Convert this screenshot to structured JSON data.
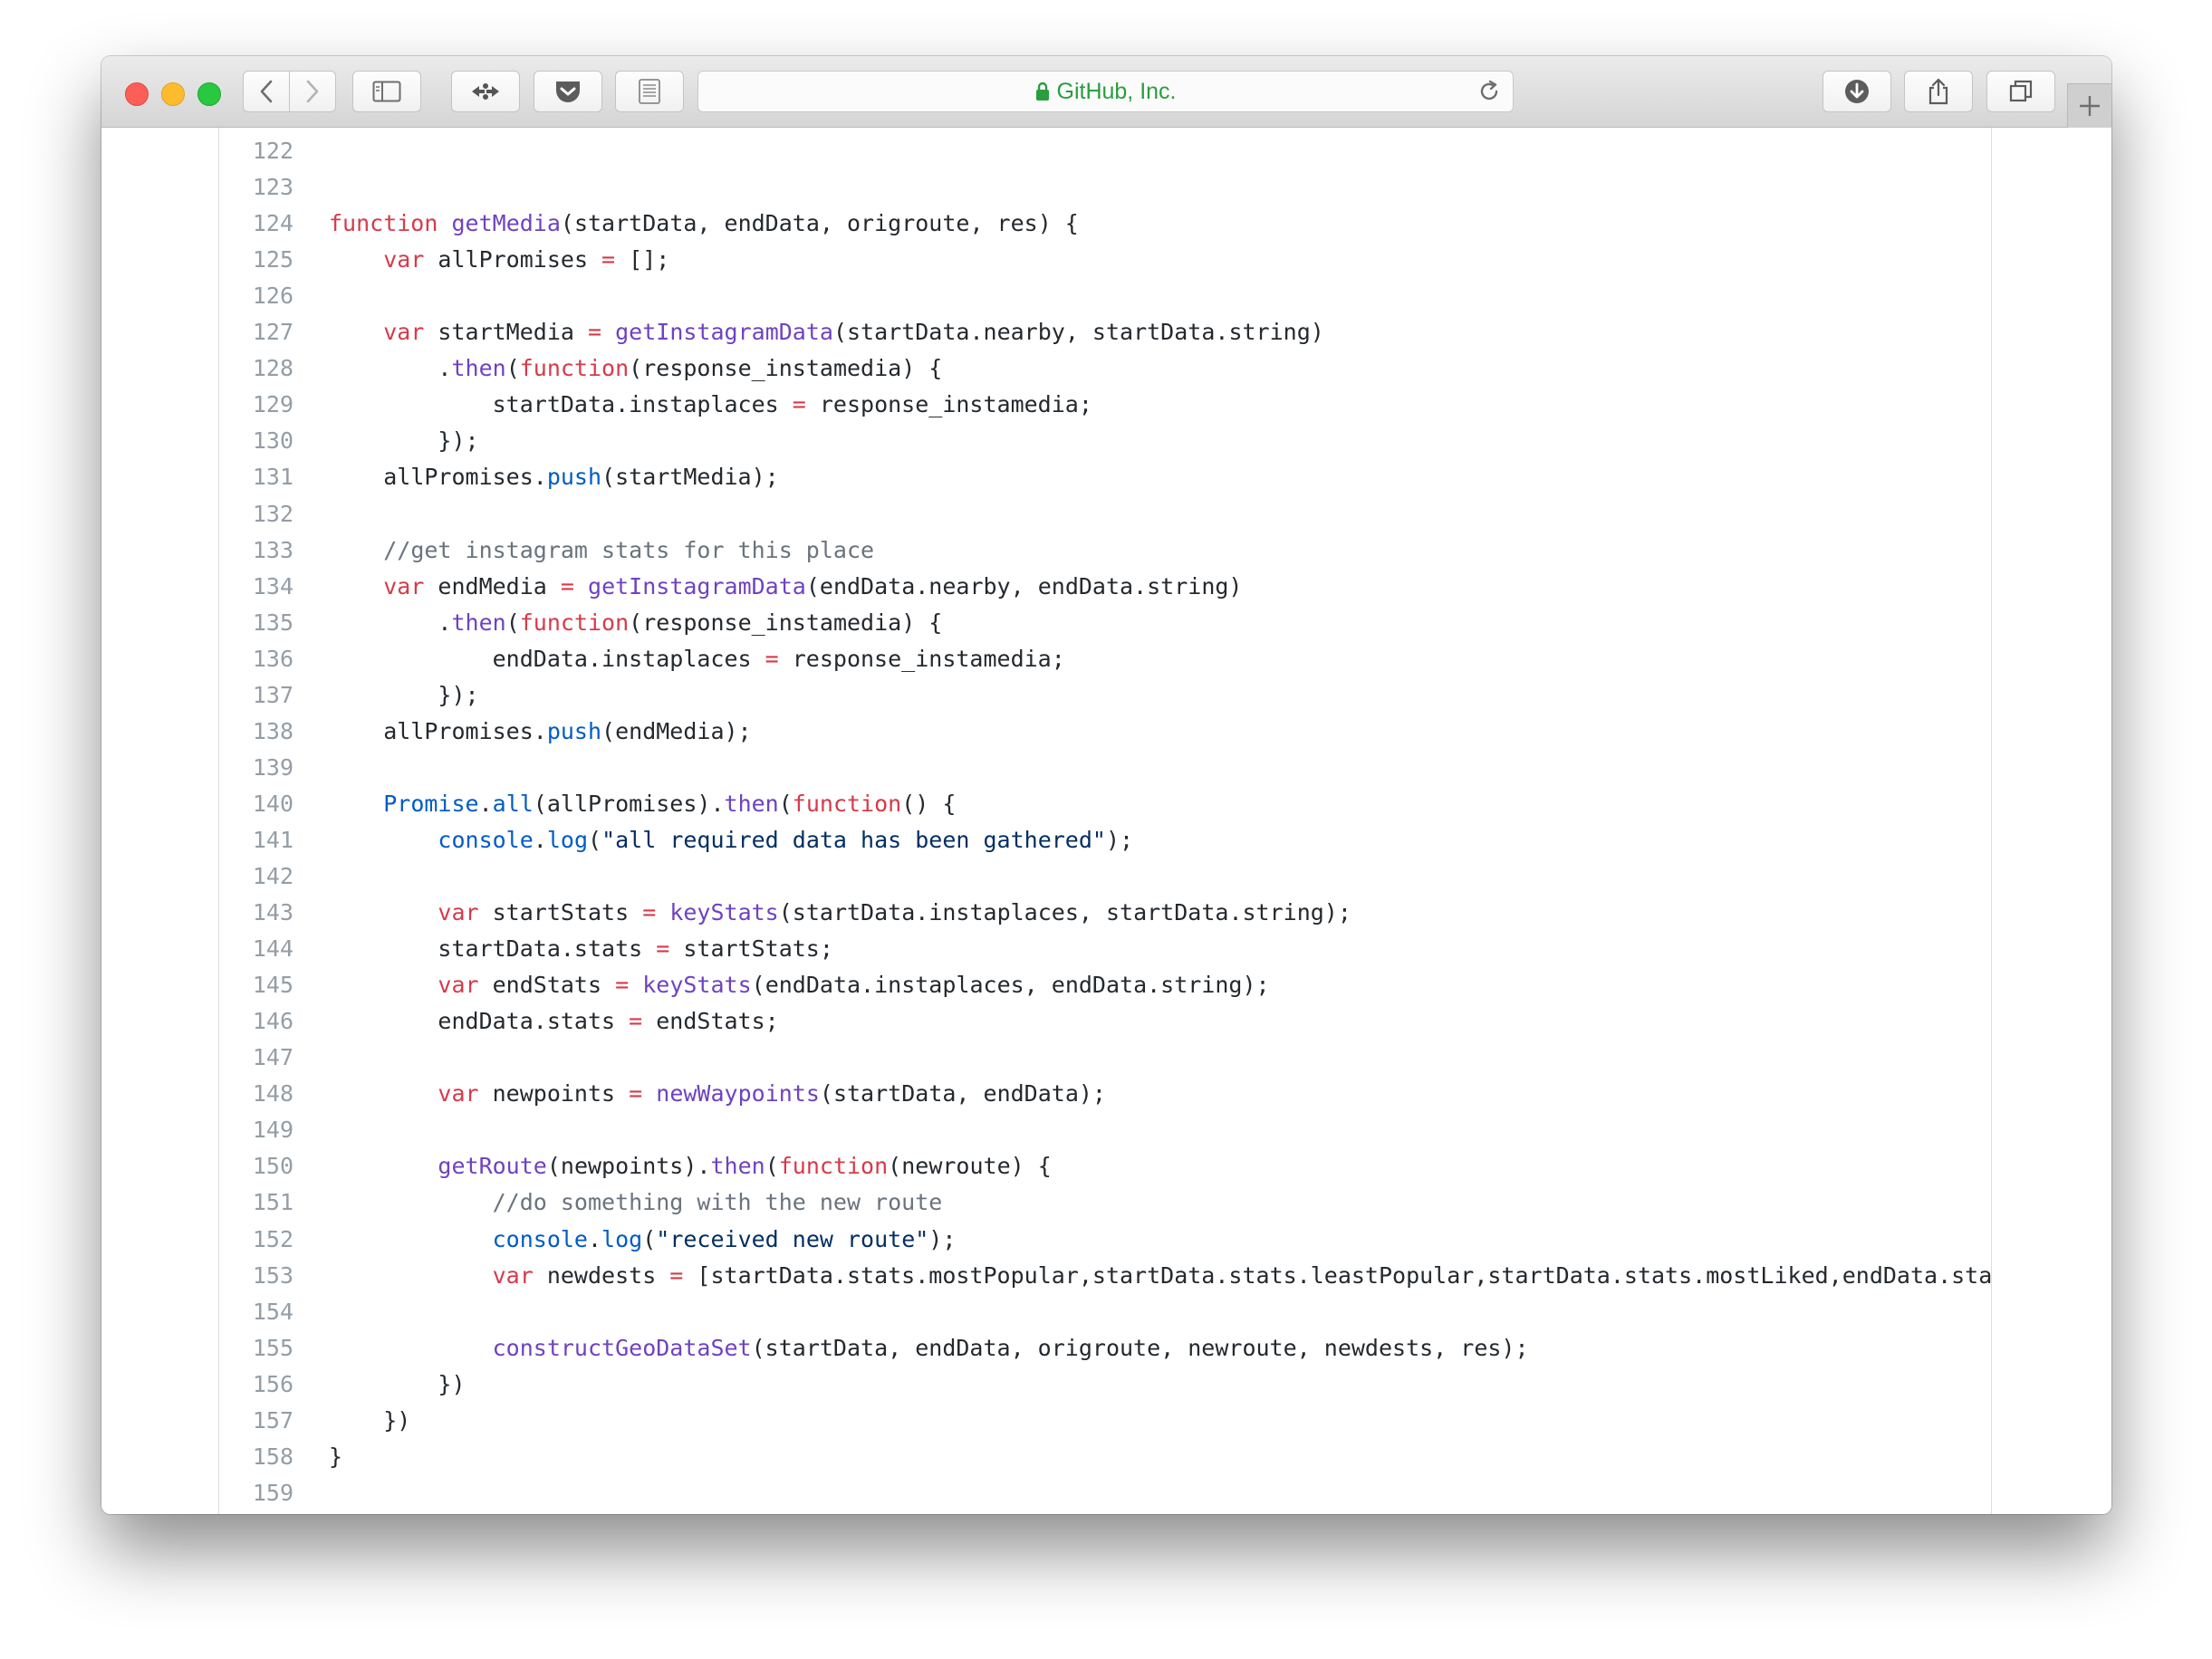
{
  "browser": {
    "address_host": "GitHub, Inc.",
    "toolbar_icons": [
      "back-icon",
      "forward-icon",
      "sidebar-icon",
      "extension-icon",
      "pocket-icon",
      "reader-icon",
      "reload-icon",
      "download-icon",
      "share-icon",
      "tabs-icon",
      "new-tab-icon"
    ]
  },
  "code": {
    "lines": [
      {
        "n": "122",
        "t": []
      },
      {
        "n": "123",
        "t": []
      },
      {
        "n": "124",
        "t": [
          [
            "k",
            "function"
          ],
          [
            "t",
            " "
          ],
          [
            "f",
            "getMedia"
          ],
          [
            "t",
            "(startData, endData, origroute, res) {"
          ]
        ]
      },
      {
        "n": "125",
        "t": [
          [
            "t",
            "    "
          ],
          [
            "k",
            "var"
          ],
          [
            "t",
            " allPromises "
          ],
          [
            "k",
            "="
          ],
          [
            "t",
            " [];"
          ]
        ]
      },
      {
        "n": "126",
        "t": []
      },
      {
        "n": "127",
        "t": [
          [
            "t",
            "    "
          ],
          [
            "k",
            "var"
          ],
          [
            "t",
            " startMedia "
          ],
          [
            "k",
            "="
          ],
          [
            "t",
            " "
          ],
          [
            "f",
            "getInstagramData"
          ],
          [
            "t",
            "(startData.nearby, startData.string)"
          ]
        ]
      },
      {
        "n": "128",
        "t": [
          [
            "t",
            "        ."
          ],
          [
            "f",
            "then"
          ],
          [
            "t",
            "("
          ],
          [
            "k",
            "function"
          ],
          [
            "t",
            "(response_instamedia) {"
          ]
        ]
      },
      {
        "n": "129",
        "t": [
          [
            "t",
            "            startData.instaplaces "
          ],
          [
            "k",
            "="
          ],
          [
            "t",
            " response_instamedia;"
          ]
        ]
      },
      {
        "n": "130",
        "t": [
          [
            "t",
            "        });"
          ]
        ]
      },
      {
        "n": "131",
        "t": [
          [
            "t",
            "    allPromises."
          ],
          [
            "b",
            "push"
          ],
          [
            "t",
            "(startMedia);"
          ]
        ]
      },
      {
        "n": "132",
        "t": []
      },
      {
        "n": "133",
        "t": [
          [
            "t",
            "    "
          ],
          [
            "c",
            "//get instagram stats for this place"
          ]
        ]
      },
      {
        "n": "134",
        "t": [
          [
            "t",
            "    "
          ],
          [
            "k",
            "var"
          ],
          [
            "t",
            " endMedia "
          ],
          [
            "k",
            "="
          ],
          [
            "t",
            " "
          ],
          [
            "f",
            "getInstagramData"
          ],
          [
            "t",
            "(endData.nearby, endData.string)"
          ]
        ]
      },
      {
        "n": "135",
        "t": [
          [
            "t",
            "        ."
          ],
          [
            "f",
            "then"
          ],
          [
            "t",
            "("
          ],
          [
            "k",
            "function"
          ],
          [
            "t",
            "(response_instamedia) {"
          ]
        ]
      },
      {
        "n": "136",
        "t": [
          [
            "t",
            "            endData.instaplaces "
          ],
          [
            "k",
            "="
          ],
          [
            "t",
            " response_instamedia;"
          ]
        ]
      },
      {
        "n": "137",
        "t": [
          [
            "t",
            "        });"
          ]
        ]
      },
      {
        "n": "138",
        "t": [
          [
            "t",
            "    allPromises."
          ],
          [
            "b",
            "push"
          ],
          [
            "t",
            "(endMedia);"
          ]
        ]
      },
      {
        "n": "139",
        "t": []
      },
      {
        "n": "140",
        "t": [
          [
            "t",
            "    "
          ],
          [
            "b",
            "Promise"
          ],
          [
            "t",
            "."
          ],
          [
            "b",
            "all"
          ],
          [
            "t",
            "(allPromises)."
          ],
          [
            "f",
            "then"
          ],
          [
            "t",
            "("
          ],
          [
            "k",
            "function"
          ],
          [
            "t",
            "() {"
          ]
        ]
      },
      {
        "n": "141",
        "t": [
          [
            "t",
            "        "
          ],
          [
            "b",
            "console"
          ],
          [
            "t",
            "."
          ],
          [
            "b",
            "log"
          ],
          [
            "t",
            "("
          ],
          [
            "s",
            "\"all required data has been gathered\""
          ],
          [
            "t",
            ");"
          ]
        ]
      },
      {
        "n": "142",
        "t": []
      },
      {
        "n": "143",
        "t": [
          [
            "t",
            "        "
          ],
          [
            "k",
            "var"
          ],
          [
            "t",
            " startStats "
          ],
          [
            "k",
            "="
          ],
          [
            "t",
            " "
          ],
          [
            "f",
            "keyStats"
          ],
          [
            "t",
            "(startData.instaplaces, startData.string);"
          ]
        ]
      },
      {
        "n": "144",
        "t": [
          [
            "t",
            "        startData.stats "
          ],
          [
            "k",
            "="
          ],
          [
            "t",
            " startStats;"
          ]
        ]
      },
      {
        "n": "145",
        "t": [
          [
            "t",
            "        "
          ],
          [
            "k",
            "var"
          ],
          [
            "t",
            " endStats "
          ],
          [
            "k",
            "="
          ],
          [
            "t",
            " "
          ],
          [
            "f",
            "keyStats"
          ],
          [
            "t",
            "(endData.instaplaces, endData.string);"
          ]
        ]
      },
      {
        "n": "146",
        "t": [
          [
            "t",
            "        endData.stats "
          ],
          [
            "k",
            "="
          ],
          [
            "t",
            " endStats;"
          ]
        ]
      },
      {
        "n": "147",
        "t": []
      },
      {
        "n": "148",
        "t": [
          [
            "t",
            "        "
          ],
          [
            "k",
            "var"
          ],
          [
            "t",
            " newpoints "
          ],
          [
            "k",
            "="
          ],
          [
            "t",
            " "
          ],
          [
            "f",
            "newWaypoints"
          ],
          [
            "t",
            "(startData, endData);"
          ]
        ]
      },
      {
        "n": "149",
        "t": []
      },
      {
        "n": "150",
        "t": [
          [
            "t",
            "        "
          ],
          [
            "f",
            "getRoute"
          ],
          [
            "t",
            "(newpoints)."
          ],
          [
            "f",
            "then"
          ],
          [
            "t",
            "("
          ],
          [
            "k",
            "function"
          ],
          [
            "t",
            "(newroute) {"
          ]
        ]
      },
      {
        "n": "151",
        "t": [
          [
            "t",
            "            "
          ],
          [
            "c",
            "//do something with the new route"
          ]
        ]
      },
      {
        "n": "152",
        "t": [
          [
            "t",
            "            "
          ],
          [
            "b",
            "console"
          ],
          [
            "t",
            "."
          ],
          [
            "b",
            "log"
          ],
          [
            "t",
            "("
          ],
          [
            "s",
            "\"received new route\""
          ],
          [
            "t",
            ");"
          ]
        ]
      },
      {
        "n": "153",
        "t": [
          [
            "t",
            "            "
          ],
          [
            "k",
            "var"
          ],
          [
            "t",
            " newdests "
          ],
          [
            "k",
            "="
          ],
          [
            "t",
            " [startData.stats.mostPopular,startData.stats.leastPopular,startData.stats.mostLiked,endData.stats.mo"
          ]
        ]
      },
      {
        "n": "154",
        "t": []
      },
      {
        "n": "155",
        "t": [
          [
            "t",
            "            "
          ],
          [
            "f",
            "constructGeoDataSet"
          ],
          [
            "t",
            "(startData, endData, origroute, newroute, newdests, res);"
          ]
        ]
      },
      {
        "n": "156",
        "t": [
          [
            "t",
            "        })"
          ]
        ]
      },
      {
        "n": "157",
        "t": [
          [
            "t",
            "    })"
          ]
        ]
      },
      {
        "n": "158",
        "t": [
          [
            "t",
            "}"
          ]
        ]
      },
      {
        "n": "159",
        "t": []
      }
    ]
  }
}
